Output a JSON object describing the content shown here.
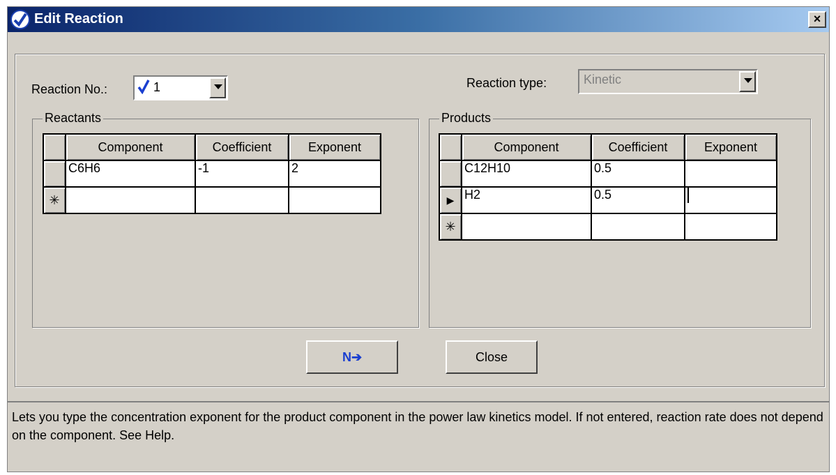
{
  "window": {
    "title": "Edit Reaction",
    "close_label": "×"
  },
  "reaction_no": {
    "label": "Reaction No.:",
    "value": "1"
  },
  "reaction_type": {
    "label": "Reaction type:",
    "value": "Kinetic"
  },
  "reactants": {
    "title": "Reactants",
    "columns": [
      "Component",
      "Coefficient",
      "Exponent"
    ],
    "rows": [
      {
        "component": "C6H6",
        "coefficient": "-1",
        "exponent": "2"
      }
    ],
    "new_row_marker": "✳"
  },
  "products": {
    "title": "Products",
    "columns": [
      "Component",
      "Coefficient",
      "Exponent"
    ],
    "rows": [
      {
        "component": "C12H10",
        "coefficient": "0.5",
        "exponent": ""
      },
      {
        "component": "H2",
        "coefficient": "0.5",
        "exponent": ""
      }
    ],
    "current_row_marker": "▶",
    "new_row_marker": "✳"
  },
  "buttons": {
    "next_label": "N➔",
    "close_label": "Close"
  },
  "status": {
    "text": "Lets you type the concentration exponent for the product component in the power law kinetics model. If not entered, reaction rate does not depend on the component. See Help."
  },
  "colors": {
    "titlebar_start": "#0a246a",
    "titlebar_end": "#a6caf0",
    "face": "#d4d0c8",
    "accent": "#1a3fd0"
  }
}
